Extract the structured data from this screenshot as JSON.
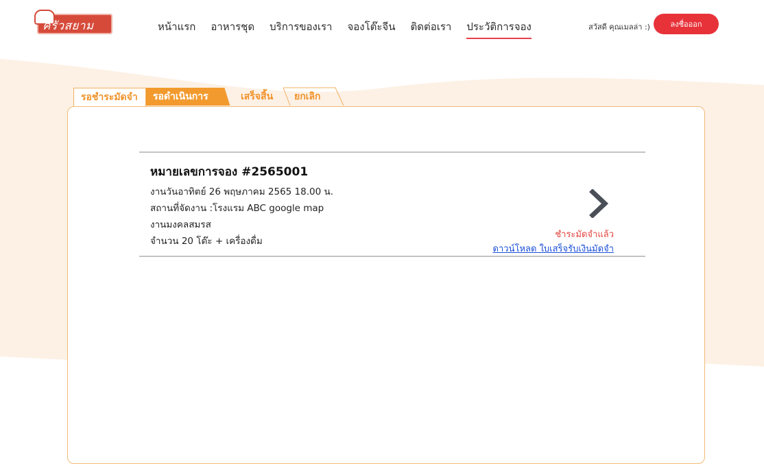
{
  "logo": {
    "text": "ครัวสยาม"
  },
  "nav": {
    "items": [
      {
        "label": "หน้าแรก",
        "active": false
      },
      {
        "label": "อาหารชุด",
        "active": false
      },
      {
        "label": "บริการของเรา",
        "active": false
      },
      {
        "label": "จองโต๊ะจีน",
        "active": false
      },
      {
        "label": "ติดต่อเรา",
        "active": false
      },
      {
        "label": "ประวัติการจอง",
        "active": true
      }
    ]
  },
  "user": {
    "greeting": "สวัสดี คุณเมลล่า :)",
    "logout_label": "ลงชื่อออก"
  },
  "tabs": [
    {
      "label": "รอชำระมัดจำ",
      "active": false
    },
    {
      "label": "รอดำเนินการ",
      "active": true
    },
    {
      "label": "เสร็จสิ้น",
      "active": false
    },
    {
      "label": "ยกเลิก",
      "active": false
    }
  ],
  "booking": {
    "title": "หมายเลขการจอง #2565001",
    "date": "งานวันอาทิตย์ 26 พฤษภาคม 2565 18.00 น.",
    "venue": "สถานที่จัดงาน :โรงแรม ABC google map",
    "event_type": "งานมงคลสมรส",
    "amount": "จำนวน 20 โต๊ะ + เครื่องดื่ม",
    "status": "ชำระมัดจำแล้ว",
    "download_link": "ดาวน์โหลด ใบเสร็จรับเงินมัดจำ"
  },
  "colors": {
    "accent_orange": "#f29a2e",
    "logout_red": "#e8323a",
    "status_red": "#e4443e",
    "link_blue": "#1a4fd8",
    "background_wave": "#fdf1e6"
  }
}
